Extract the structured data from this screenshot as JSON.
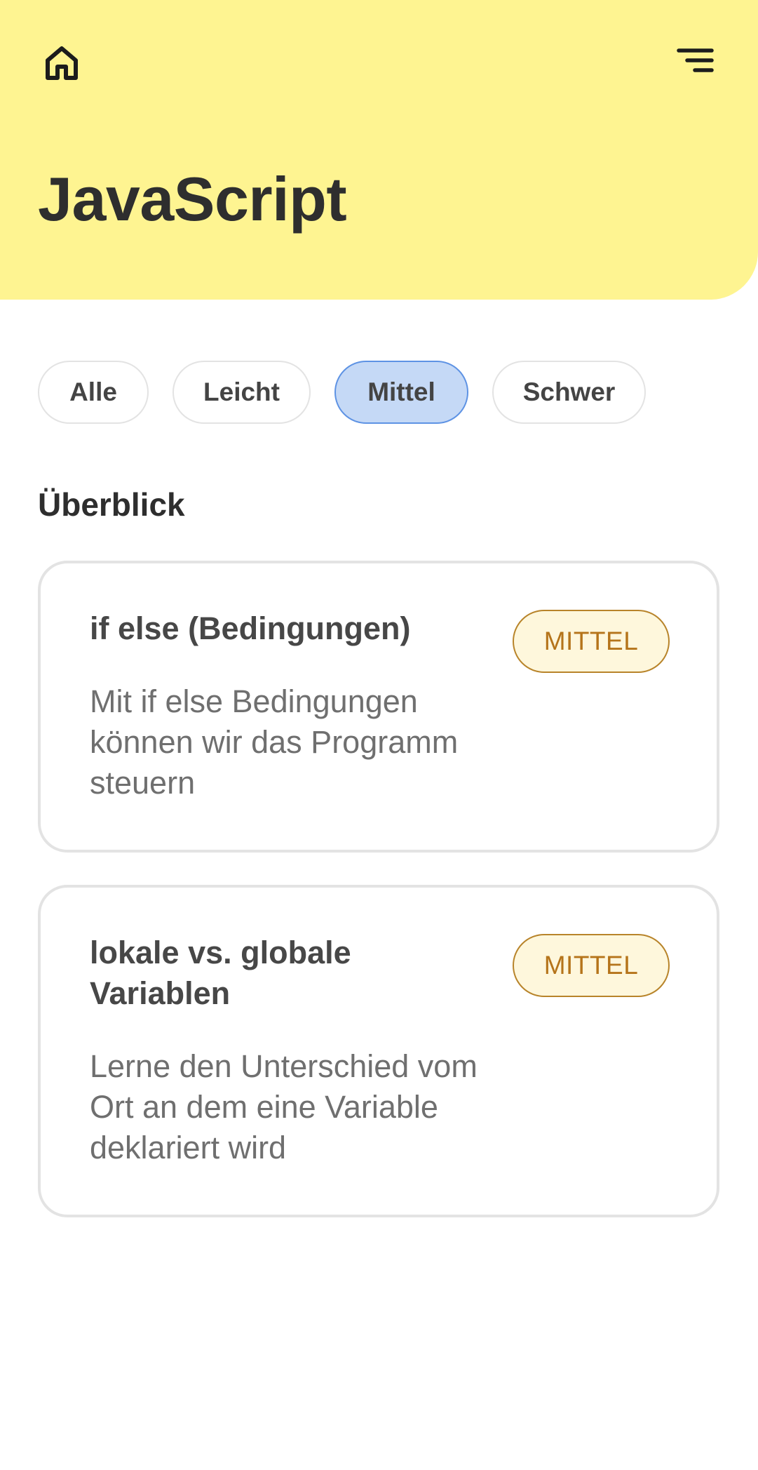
{
  "header": {
    "home_icon": "home-icon",
    "menu_icon": "menu-icon",
    "title": "JavaScript",
    "background_color": "#fef491"
  },
  "filters": {
    "items": [
      {
        "label": "Alle"
      },
      {
        "label": "Leicht"
      },
      {
        "label": "Mittel"
      },
      {
        "label": "Schwer"
      }
    ],
    "selected": "Mittel",
    "active_color": "#c5d9f6"
  },
  "overview": {
    "title": "Überblick",
    "cards": [
      {
        "title": "if else (Bedingungen)",
        "description": "Mit if else Bedingungen können wir das Programm steuern",
        "level": "MITTEL"
      },
      {
        "title": "lokale vs. globale Variablen",
        "description": "Lerne den Unterschied vom Ort an dem eine Variable deklariert wird",
        "level": "MITTEL"
      }
    ]
  },
  "colors": {
    "badge_text": "#b5741a",
    "badge_background": "#fef7dc"
  }
}
